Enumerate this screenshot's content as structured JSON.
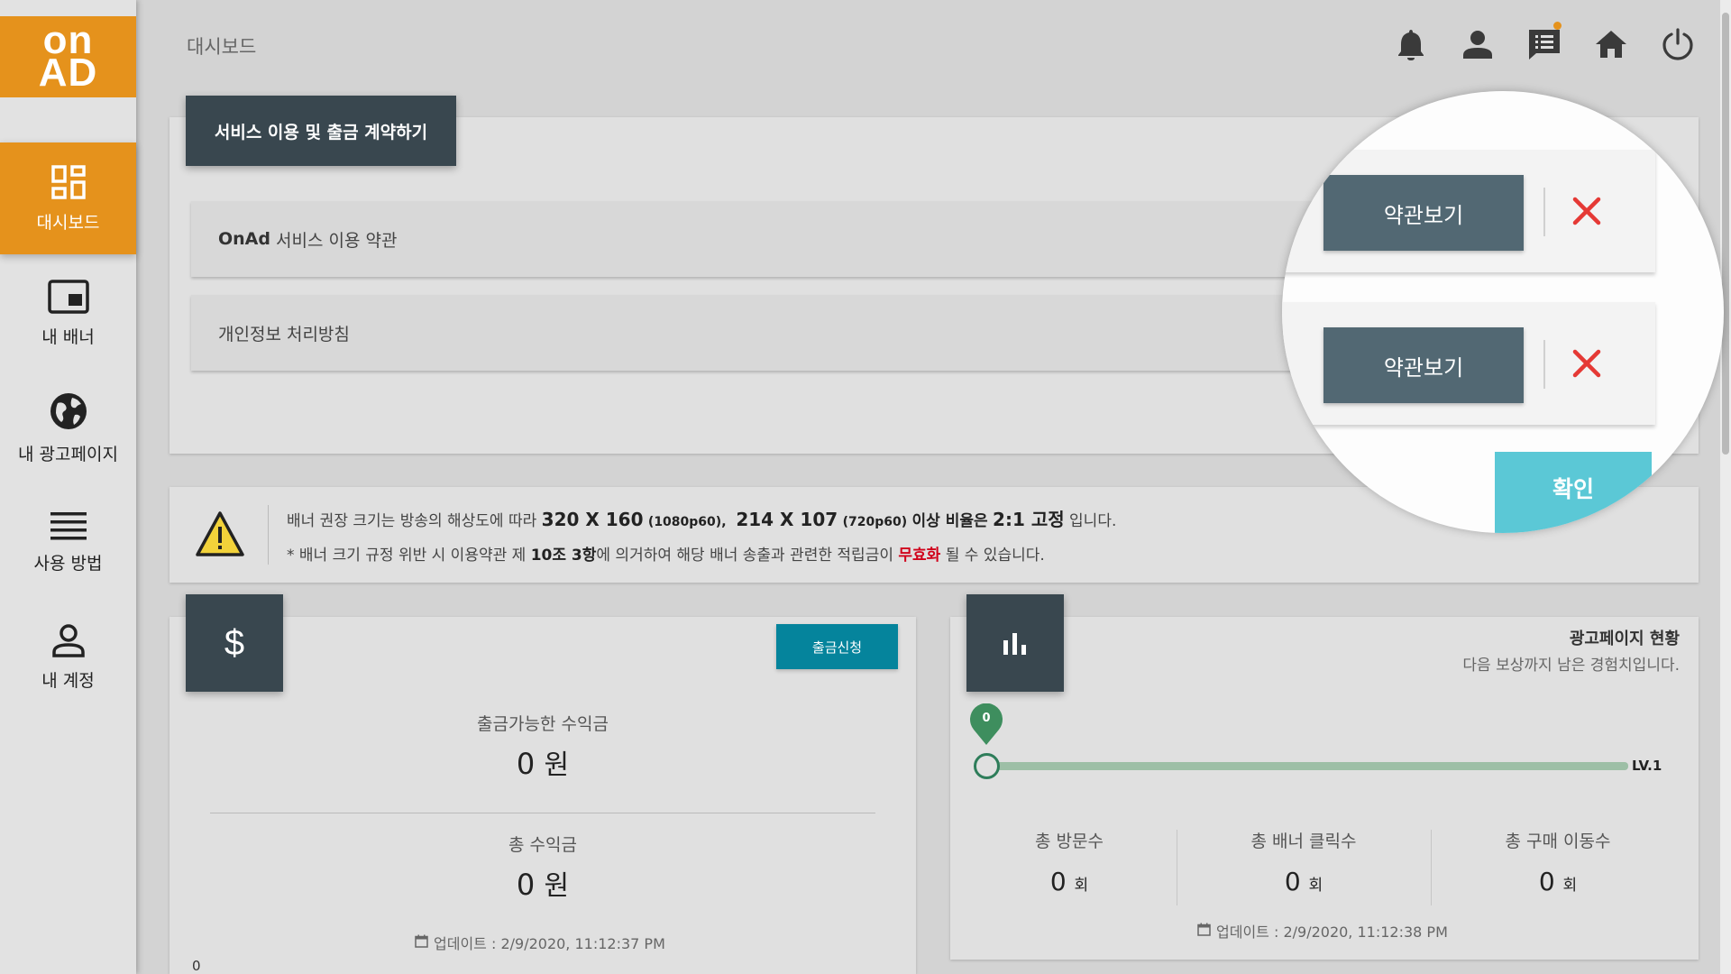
{
  "app": {
    "logo_top": "on",
    "logo_bottom": "AD"
  },
  "sidebar": {
    "items": [
      {
        "label": "대시보드",
        "icon": "dashboard-icon",
        "active": true
      },
      {
        "label": "내 배너",
        "icon": "banner-icon",
        "active": false
      },
      {
        "label": "내 광고페이지",
        "icon": "globe-icon",
        "active": false
      },
      {
        "label": "사용 방법",
        "icon": "menu-lines-icon",
        "active": false
      },
      {
        "label": "내 계정",
        "icon": "account-icon",
        "active": false
      }
    ]
  },
  "header": {
    "title": "대시보드",
    "icons": [
      "bell-icon",
      "user-icon",
      "notice-board-icon",
      "home-icon",
      "power-icon"
    ]
  },
  "contract": {
    "header": "서비스 이용 및 출금 계약하기",
    "terms": [
      {
        "bold": "OnAd",
        "label": "서비스 이용 약관"
      },
      {
        "bold": "",
        "label": "개인정보 처리방침"
      }
    ],
    "view_button": "약관보기",
    "confirm_button": "확인"
  },
  "notice": {
    "line1_pre": "배너 권장 크기는 방송의 해상도에 따라",
    "size1": "320 X 160",
    "res1": "(1080p60),",
    "size2": "214 X 107",
    "res2": "(720p60)",
    "ratio_label": "이상 비율은",
    "ratio_value": "2:1 고정",
    "line1_post": "입니다.",
    "line2_pre": "* 배너 크기 규정 위반 시 이용약관 제",
    "line2_art": "10조 3항",
    "line2_mid": "에 의거하여 해당 배너 송출과 관련한 적립금이",
    "line2_red": "무효화",
    "line2_post": "될 수 있습니다."
  },
  "revenue": {
    "icon": "dollar-icon",
    "withdraw_button": "출금신청",
    "available_label": "출금가능한 수익금",
    "available_value": "0",
    "available_unit": "원",
    "total_label": "총 수익금",
    "total_value": "0",
    "total_unit": "원",
    "updated": "업데이트 : 2/9/2020, 11:12:37 PM",
    "stray_value": "0"
  },
  "adpage": {
    "icon": "bar-chart-icon",
    "title": "광고페이지 현황",
    "subtitle": "다음 보상까지 남은 경험치입니다.",
    "progress_value": "0",
    "progress_fraction": 0,
    "level_label": "LV.1",
    "stats": [
      {
        "label": "총 방문수",
        "value": "0",
        "unit": "회"
      },
      {
        "label": "총 배너 클릭수",
        "value": "0",
        "unit": "회"
      },
      {
        "label": "총 구매 이동수",
        "value": "0",
        "unit": "회"
      }
    ],
    "updated": "업데이트 : 2/9/2020, 11:12:38 PM"
  },
  "colors": {
    "brand": "#e5921c",
    "dark_header": "#39474f",
    "teal_button": "#05849c",
    "terms_button": "#526873",
    "confirm": "#5bc8d6",
    "close_x": "#e53935",
    "progress": "#2e7d5a"
  }
}
